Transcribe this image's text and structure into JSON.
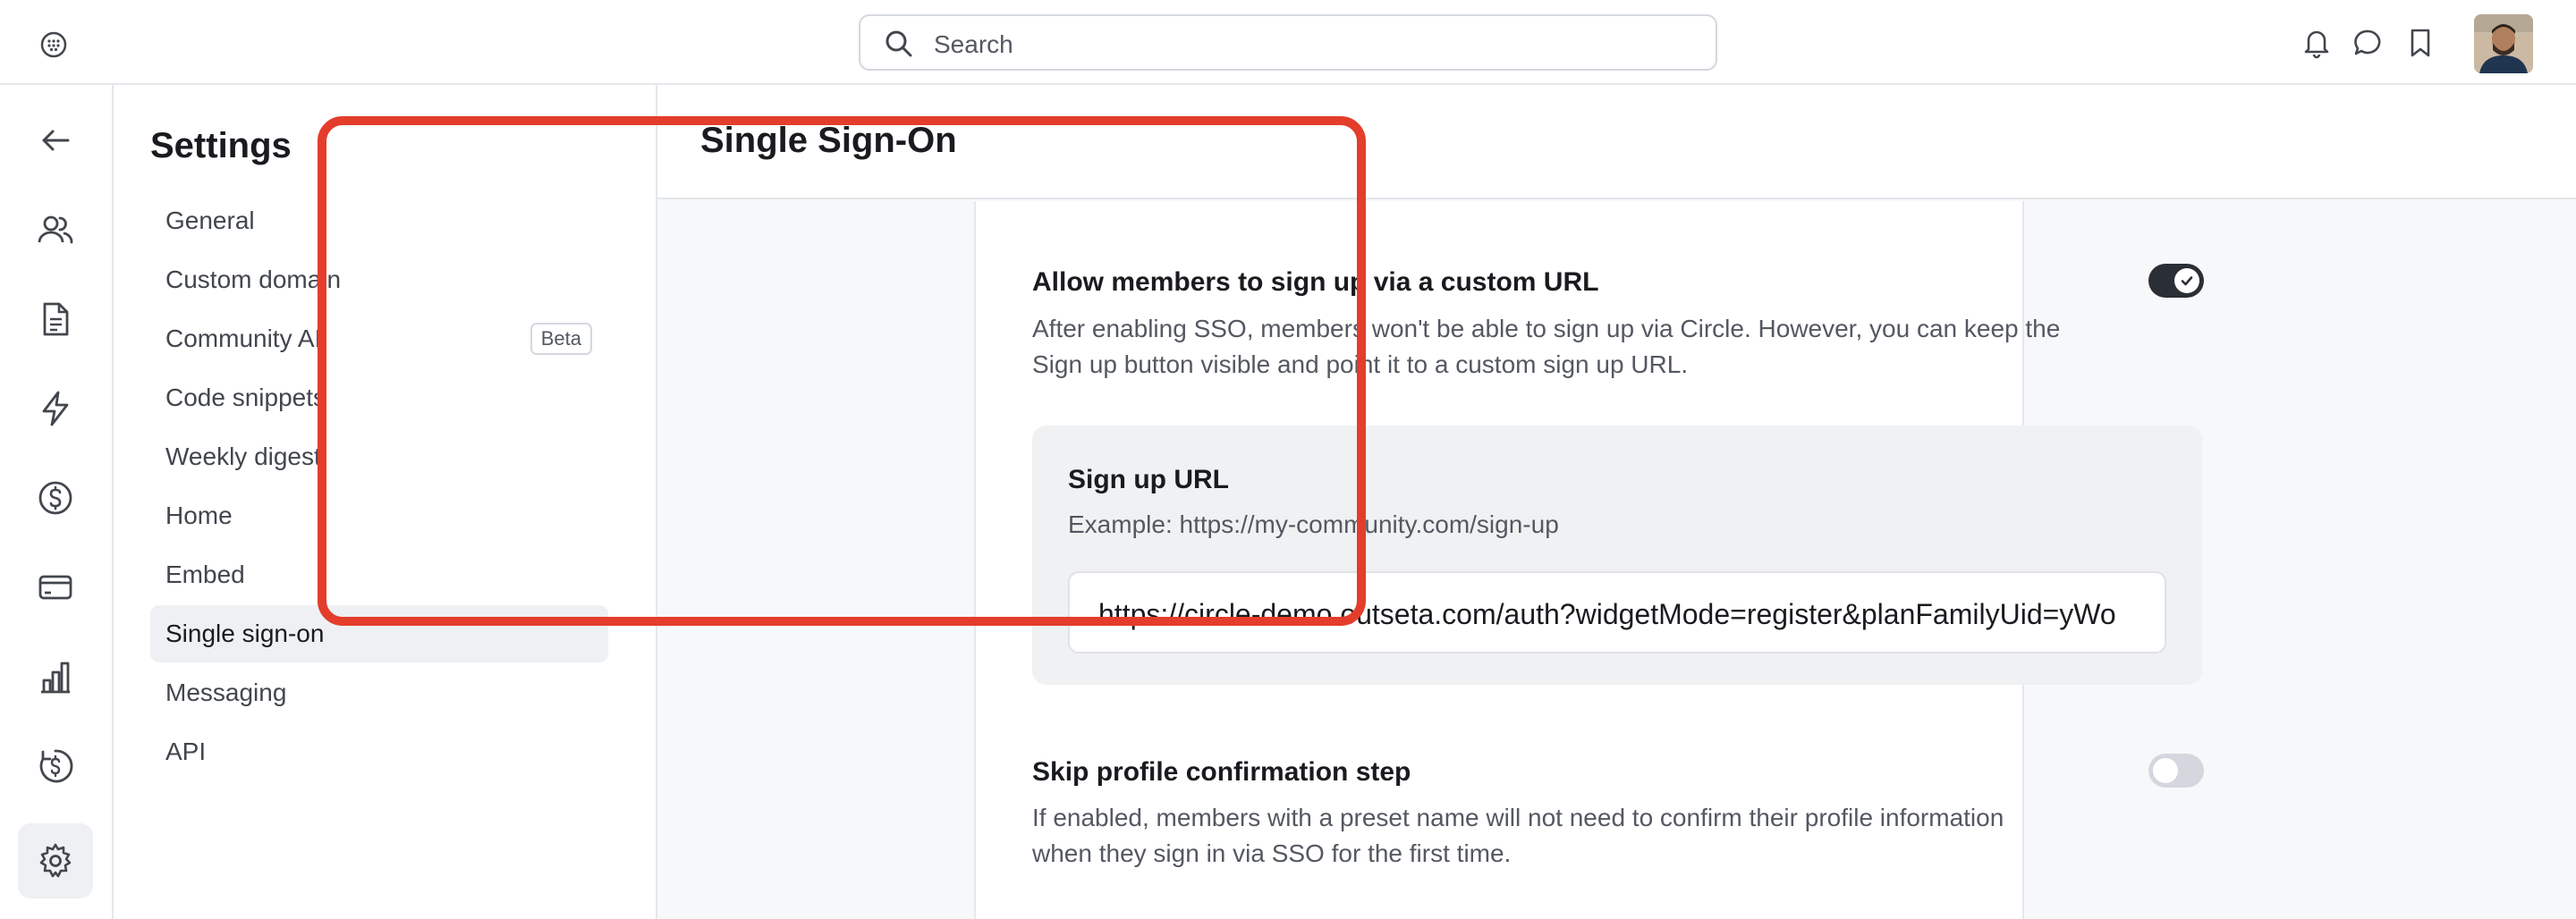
{
  "topbar": {
    "search_placeholder": "Search"
  },
  "settings": {
    "title": "Settings",
    "items": [
      {
        "label": "General"
      },
      {
        "label": "Custom domain"
      },
      {
        "label": "Community AI",
        "badge": "Beta"
      },
      {
        "label": "Code snippets"
      },
      {
        "label": "Weekly digest"
      },
      {
        "label": "Home"
      },
      {
        "label": "Embed"
      },
      {
        "label": "Single sign-on",
        "active": true
      },
      {
        "label": "Messaging"
      },
      {
        "label": "API"
      }
    ]
  },
  "rail": {
    "icons": [
      "back-arrow-icon",
      "members-icon",
      "document-icon",
      "lightning-icon",
      "dollar-icon",
      "card-icon",
      "analytics-icon",
      "paywall-icon",
      "settings-icon"
    ],
    "active": "settings-icon"
  },
  "main": {
    "title": "Single Sign-On",
    "custom_url": {
      "title": "Allow members to sign up via a custom URL",
      "desc_line1": "After enabling SSO, members won't be able to sign up via Circle. However, you can keep the",
      "desc_line2": "Sign up button visible and point it to a custom sign up URL.",
      "enabled": true,
      "url_label": "Sign up URL",
      "url_example": "Example: https://my-community.com/sign-up",
      "url_value": "https://circle-demo.outseta.com/auth?widgetMode=register&planFamilyUid=yWo"
    },
    "skip_profile": {
      "title": "Skip profile confirmation step",
      "desc_line1": "If enabled, members with a preset name will not need to confirm their profile information",
      "desc_line2": "when they sign in via SSO for the first time.",
      "enabled": false
    }
  },
  "colors": {
    "highlight": "#e43d2b",
    "toggle_on": "#2a2e35",
    "toggle_off": "#d4d8de",
    "active_bg": "#eef0f3"
  }
}
